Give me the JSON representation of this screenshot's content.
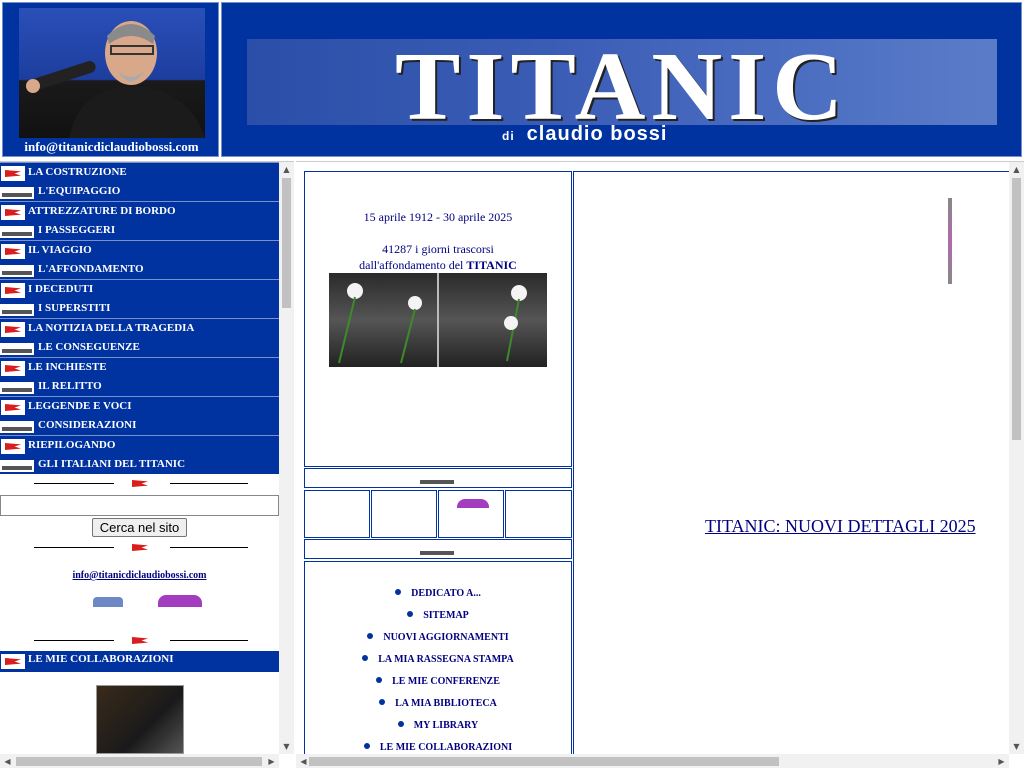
{
  "header": {
    "author_email": "info@titanicdiclaudiobossi.com",
    "banner_title": "TITANIC",
    "banner_di": "di",
    "banner_author": "claudio bossi"
  },
  "sidebar": {
    "items": [
      {
        "label": "LA COSTRUZIONE",
        "icon": "flag-icon"
      },
      {
        "label": "L'EQUIPAGGIO",
        "icon": "ship-icon"
      },
      {
        "label": "ATTREZZATURE DI BORDO",
        "icon": "flag-icon"
      },
      {
        "label": "I PASSEGGERI",
        "icon": "ship-icon"
      },
      {
        "label": "IL VIAGGIO",
        "icon": "flag-icon"
      },
      {
        "label": "L'AFFONDAMENTO",
        "icon": "ship-icon"
      },
      {
        "label": "I DECEDUTI",
        "icon": "flag-icon"
      },
      {
        "label": "I SUPERSTITI",
        "icon": "ship-icon"
      },
      {
        "label": "LA NOTIZIA DELLA TRAGEDIA",
        "icon": "flag-icon"
      },
      {
        "label": "LE CONSEGUENZE",
        "icon": "ship-icon"
      },
      {
        "label": "LE INCHIESTE",
        "icon": "flag-icon"
      },
      {
        "label": "IL RELITTO",
        "icon": "ship-icon"
      },
      {
        "label": "LEGGENDE E VOCI",
        "icon": "flag-icon"
      },
      {
        "label": "CONSIDERAZIONI",
        "icon": "ship-icon"
      },
      {
        "label": "RIEPILOGANDO",
        "icon": "flag-icon"
      },
      {
        "label": "GLI ITALIANI DEL TITANIC",
        "icon": "ship-icon"
      }
    ],
    "search_button": "Cerca nel sito",
    "email": "info@titanicdiclaudiobossi.com",
    "collab_title": "LE MIE COLLABORAZIONI"
  },
  "main": {
    "date_range": "15 aprile 1912 - 30 aprile 2025",
    "days_line": "41287 i giorni trascorsi",
    "since_line": "dall'affondamento del",
    "since_strong": "TITANIC",
    "links": [
      "DEDICATO A...",
      "SITEMAP",
      "NUOVI AGGIORNAMENTI",
      "LA MIA RASSEGNA STAMPA",
      "LE MIE CONFERENZE",
      "LA MIA BIBLIOTECA",
      "MY LIBRARY",
      "LE  MIE COLLABORAZIONI"
    ],
    "news_link": "TITANIC: NUOVI DETTAGLI 2025"
  },
  "colors": {
    "nav_blue": "#0033a0",
    "link_navy": "#000080",
    "flag_red": "#d81e1e"
  }
}
